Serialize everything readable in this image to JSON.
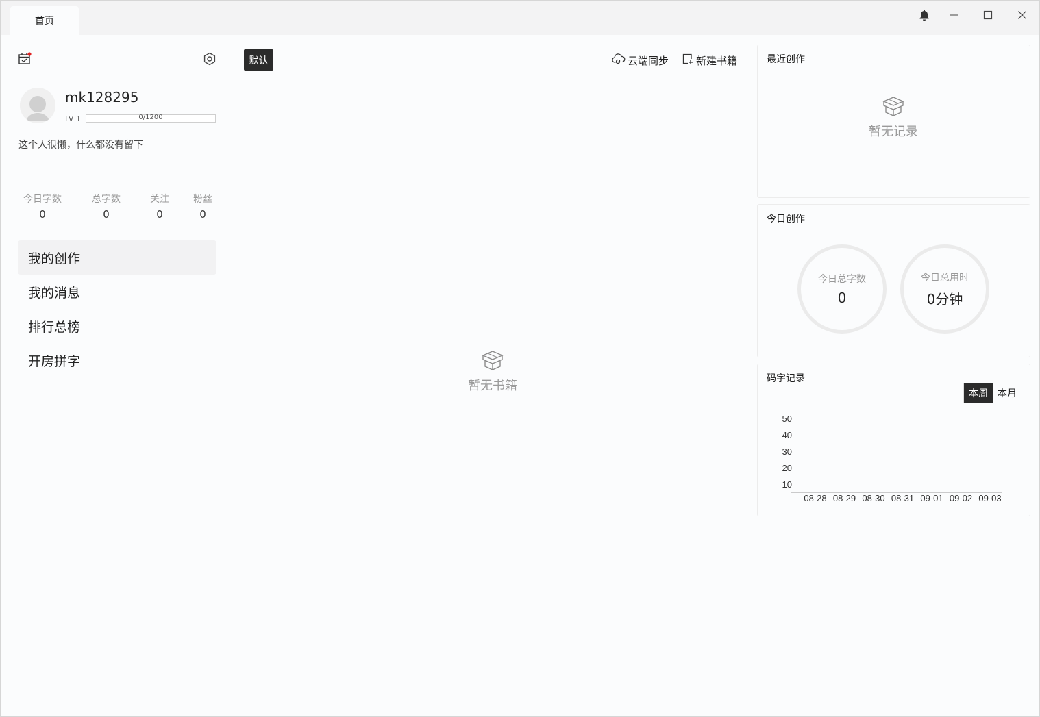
{
  "tabs": [
    {
      "label": "首页"
    }
  ],
  "profile": {
    "username": "mk128295",
    "level": "LV 1",
    "exp_text": "0/1200",
    "exp_fraction": 0,
    "bio": "这个人很懒，什么都没有留下"
  },
  "stats": [
    {
      "label": "今日字数",
      "value": "0"
    },
    {
      "label": "总字数",
      "value": "0"
    },
    {
      "label": "关注",
      "value": "0"
    },
    {
      "label": "粉丝",
      "value": "0"
    }
  ],
  "nav": [
    {
      "label": "我的创作",
      "active": true
    },
    {
      "label": "我的消息",
      "active": false
    },
    {
      "label": "排行总榜",
      "active": false
    },
    {
      "label": "开房拼字",
      "active": false
    }
  ],
  "toolbar": {
    "default_label": "默认",
    "sync_label": "云端同步",
    "new_book_label": "新建书籍"
  },
  "books_empty": "暂无书籍",
  "recent": {
    "title": "最近创作",
    "empty": "暂无记录"
  },
  "today": {
    "title": "今日创作",
    "total_words_label": "今日总字数",
    "total_words_value": "0",
    "total_time_label": "今日总用时",
    "total_time_value": "0分钟"
  },
  "typing": {
    "title": "码字记录",
    "week_label": "本周",
    "month_label": "本月"
  },
  "chart_data": {
    "type": "bar",
    "categories": [
      "08-28",
      "08-29",
      "08-30",
      "08-31",
      "09-01",
      "09-02",
      "09-03"
    ],
    "values": [
      0,
      0,
      0,
      0,
      0,
      0,
      0
    ],
    "yticks": [
      "50",
      "40",
      "30",
      "20",
      "10"
    ],
    "ylim": [
      0,
      50
    ],
    "title": "",
    "xlabel": "",
    "ylabel": "",
    "grid": false
  },
  "colors": {
    "accent": "#2b2b2b",
    "notify_dot": "#e02020"
  }
}
